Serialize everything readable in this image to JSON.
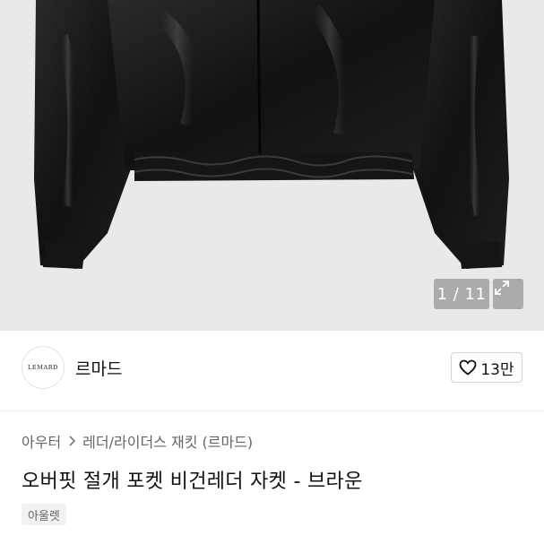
{
  "gallery": {
    "counter": "1 / 11"
  },
  "shop": {
    "logo_text": "LEMARD",
    "name": "르마드",
    "likes": "13만"
  },
  "breadcrumb": {
    "items": [
      "아우터",
      "레더/라이더스 재킷 (르마드)"
    ]
  },
  "product": {
    "title": "오버핏 절개 포켓 비건레더 자켓 - 브라운",
    "tag": "아울렛"
  },
  "icons": {
    "expand": "expand-icon",
    "heart": "heart-icon",
    "chevron": "chevron-right-icon"
  }
}
